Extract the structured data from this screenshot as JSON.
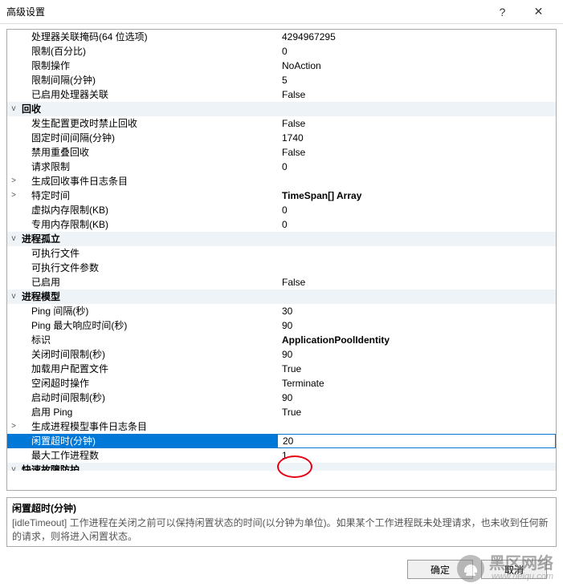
{
  "window": {
    "title": "高级设置",
    "help_icon": "?",
    "close_icon": "✕"
  },
  "rows": [
    {
      "type": "prop",
      "label": "处理器关联掩码(64 位选项)",
      "value": "4294967295"
    },
    {
      "type": "prop",
      "label": "限制(百分比)",
      "value": "0"
    },
    {
      "type": "prop",
      "label": "限制操作",
      "value": "NoAction"
    },
    {
      "type": "prop",
      "label": "限制间隔(分钟)",
      "value": "5"
    },
    {
      "type": "prop",
      "label": "已启用处理器关联",
      "value": "False"
    },
    {
      "type": "cat",
      "exp": "v",
      "label": "回收"
    },
    {
      "type": "prop",
      "label": "发生配置更改时禁止回收",
      "value": "False"
    },
    {
      "type": "prop",
      "label": "固定时间间隔(分钟)",
      "value": "1740"
    },
    {
      "type": "prop",
      "label": "禁用重叠回收",
      "value": "False"
    },
    {
      "type": "prop",
      "label": "请求限制",
      "value": "0"
    },
    {
      "type": "prop",
      "exp": ">",
      "label": "生成回收事件日志条目"
    },
    {
      "type": "prop",
      "exp": ">",
      "label": "特定时间",
      "value": "TimeSpan[] Array",
      "bold": true
    },
    {
      "type": "prop",
      "label": "虚拟内存限制(KB)",
      "value": "0"
    },
    {
      "type": "prop",
      "label": "专用内存限制(KB)",
      "value": "0"
    },
    {
      "type": "cat",
      "exp": "v",
      "label": "进程孤立"
    },
    {
      "type": "prop",
      "label": "可执行文件",
      "value": ""
    },
    {
      "type": "prop",
      "label": "可执行文件参数",
      "value": ""
    },
    {
      "type": "prop",
      "label": "已启用",
      "value": "False"
    },
    {
      "type": "cat",
      "exp": "v",
      "label": "进程模型"
    },
    {
      "type": "prop",
      "label": "Ping 间隔(秒)",
      "value": "30"
    },
    {
      "type": "prop",
      "label": "Ping 最大响应时间(秒)",
      "value": "90"
    },
    {
      "type": "prop",
      "label": "标识",
      "value": "ApplicationPoolIdentity",
      "bold": true
    },
    {
      "type": "prop",
      "label": "关闭时间限制(秒)",
      "value": "90"
    },
    {
      "type": "prop",
      "label": "加载用户配置文件",
      "value": "True"
    },
    {
      "type": "prop",
      "label": "空闲超时操作",
      "value": "Terminate"
    },
    {
      "type": "prop",
      "label": "启动时间限制(秒)",
      "value": "90"
    },
    {
      "type": "prop",
      "label": "启用 Ping",
      "value": "True"
    },
    {
      "type": "prop",
      "exp": ">",
      "label": "生成进程模型事件日志条目"
    },
    {
      "type": "sel",
      "label": "闲置超时(分钟)",
      "value": "20"
    },
    {
      "type": "prop",
      "label": "最大工作进程数",
      "value": "1"
    },
    {
      "type": "cat",
      "exp": "v",
      "label": "快速故障防护",
      "cut": true
    }
  ],
  "description": {
    "title": "闲置超时(分钟)",
    "body": "[idleTimeout] 工作进程在关闭之前可以保持闲置状态的时间(以分钟为单位)。如果某个工作进程既未处理请求，也未收到任何新的请求，则将进入闲置状态。"
  },
  "buttons": {
    "ok": "确定",
    "cancel": "取消"
  },
  "watermark": {
    "text": "黑区网络",
    "sub": "www.heiqu.com"
  }
}
